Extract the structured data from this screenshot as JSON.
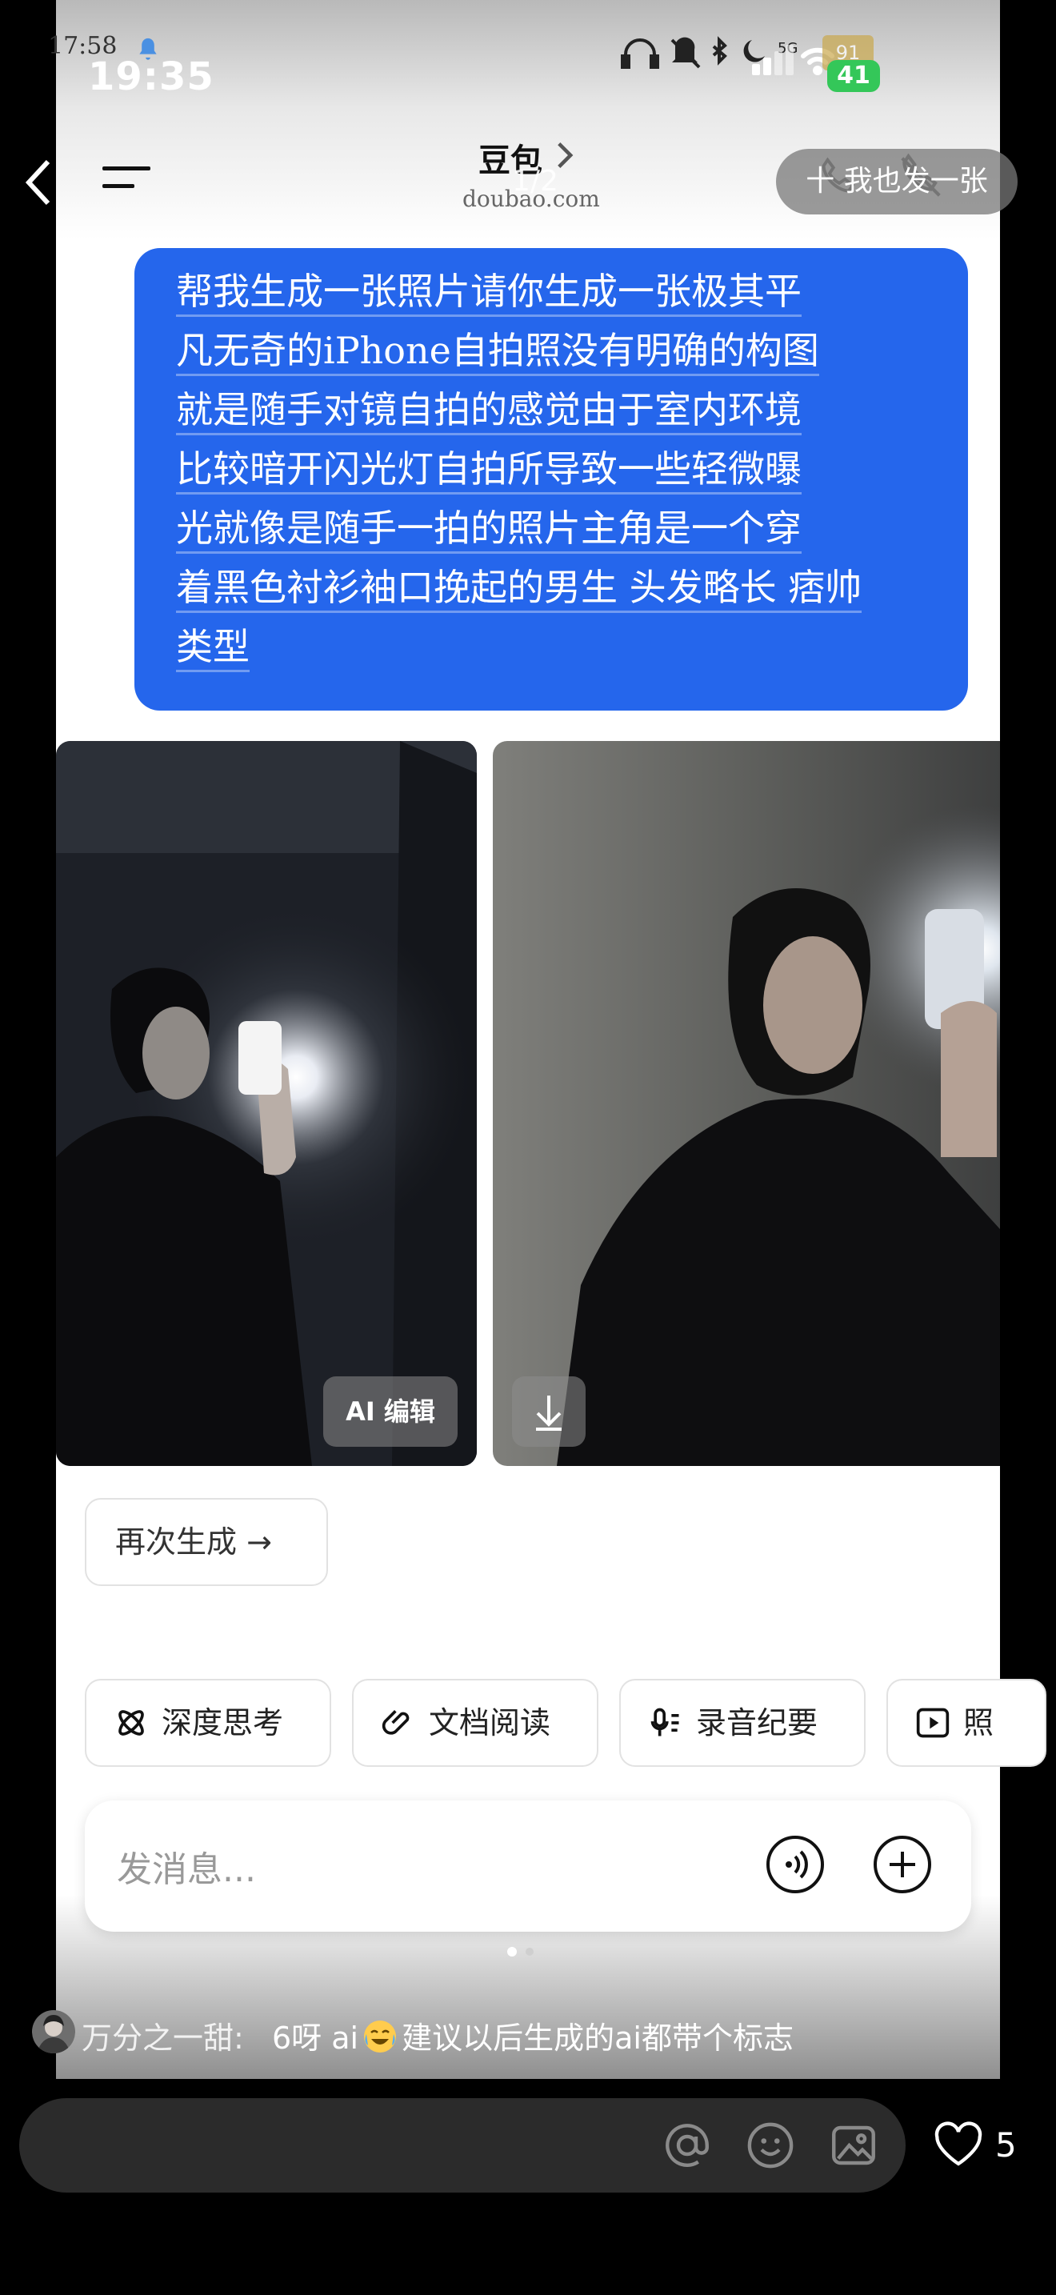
{
  "status_bar": {
    "time_small": "17:58",
    "time": "19:35",
    "battery_small": "91",
    "battery": "41"
  },
  "header": {
    "title": "豆包",
    "domain": "doubao.com",
    "page_indicator": "1/2",
    "action_pill": "十 我也发一张"
  },
  "chat": {
    "user_message_lines": [
      "帮我生成一张照片请你生成一张极其平",
      "凡无奇的iPhone自拍照没有明确的构图",
      "就是随手对镜自拍的感觉由于室内环境",
      "比较暗开闪光灯自拍所导致一些轻微曝",
      "光就像是随手一拍的照片主角是一个穿",
      "着黑色衬衫袖口挽起的男生 头发略长 痞帅",
      "类型"
    ],
    "ai_edit_label": "AI 编辑",
    "regenerate_label": "再次生成 →"
  },
  "chips": [
    {
      "label": "深度思考",
      "icon": "atom-icon"
    },
    {
      "label": "文档阅读",
      "icon": "paperclip-icon"
    },
    {
      "label": "录音纪要",
      "icon": "microphone-icon"
    },
    {
      "label": "照",
      "icon": "play-icon"
    }
  ],
  "composer": {
    "placeholder": "发消息..."
  },
  "comment": {
    "user": "万分之一甜:",
    "text_before_emoji": "6呀 ai",
    "text_after_emoji": "建议以后生成的ai都带个标志"
  },
  "bottom_bar": {
    "like_count": "5"
  },
  "colors": {
    "bubble_blue": "#2566ec",
    "battery_green": "#34c759"
  }
}
